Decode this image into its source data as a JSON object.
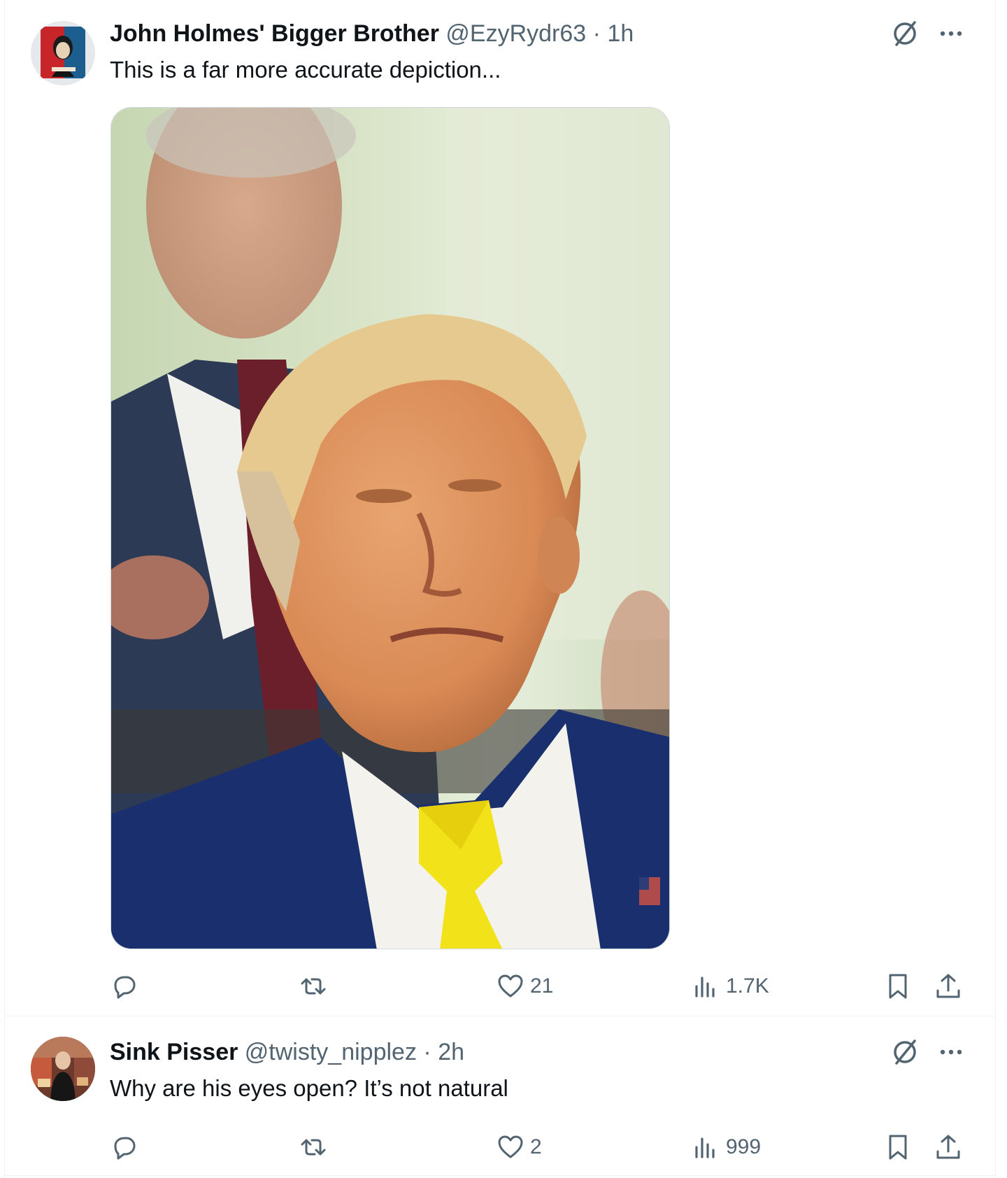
{
  "posts": [
    {
      "author_name": "John Holmes' Bigger Brother",
      "handle": "@EzyRydr63",
      "separator": "·",
      "time": "1h",
      "text": "This is a far more accurate depiction...",
      "has_media": true,
      "media_icon": "photo-of-man-with-eyes-closed",
      "replies": "",
      "reposts": "",
      "likes": "21",
      "views": "1.7K"
    },
    {
      "author_name": "Sink Pisser",
      "handle": "@twisty_nipplez",
      "separator": "·",
      "time": "2h",
      "text": "Why are his eyes open? It’s not natural",
      "has_media": false,
      "replies": "",
      "reposts": "",
      "likes": "2",
      "views": "999"
    }
  ],
  "colors": {
    "text_primary": "#0f1419",
    "text_secondary": "#536471",
    "border": "#eff3f4"
  }
}
